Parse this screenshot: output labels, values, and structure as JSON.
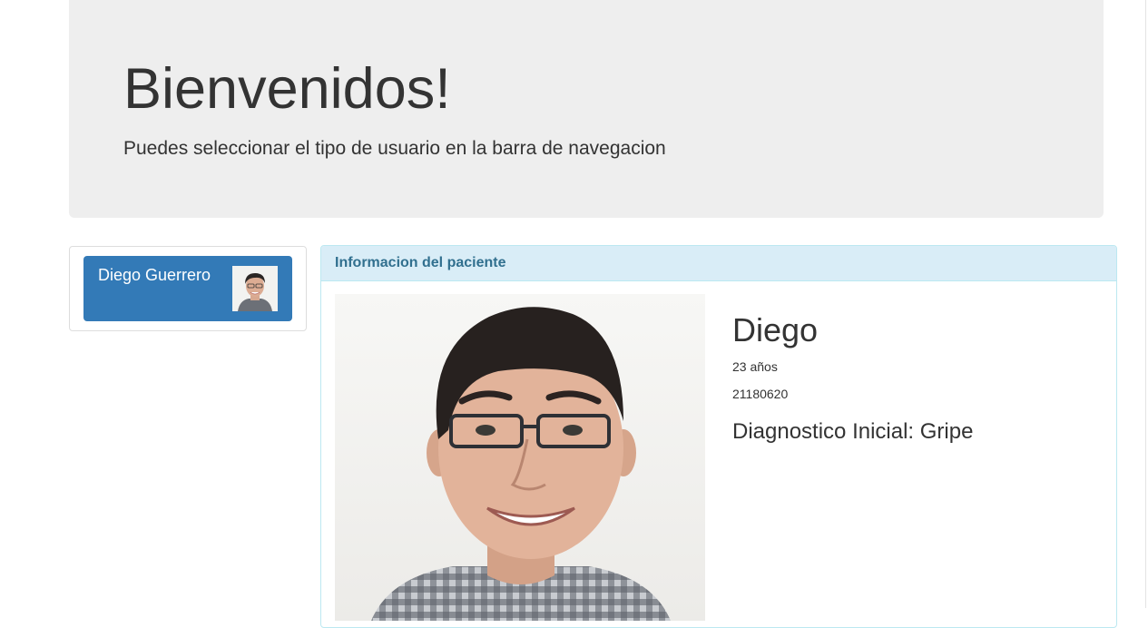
{
  "jumbotron": {
    "title": "Bienvenidos!",
    "subtitle": "Puedes seleccionar el tipo de usuario en la barra de navegacion"
  },
  "patient_list": {
    "items": [
      {
        "name": "Diego Guerrero",
        "avatar": "patient-photo"
      }
    ],
    "active_color": "#337ab7"
  },
  "patient_panel": {
    "heading": "Informacion del paciente",
    "photo": "patient-photo",
    "name": "Diego",
    "age": "23 años",
    "id_number": "21180620",
    "diagnosis": "Diagnostico Inicial: Gripe",
    "heading_color": "#d9edf7"
  }
}
